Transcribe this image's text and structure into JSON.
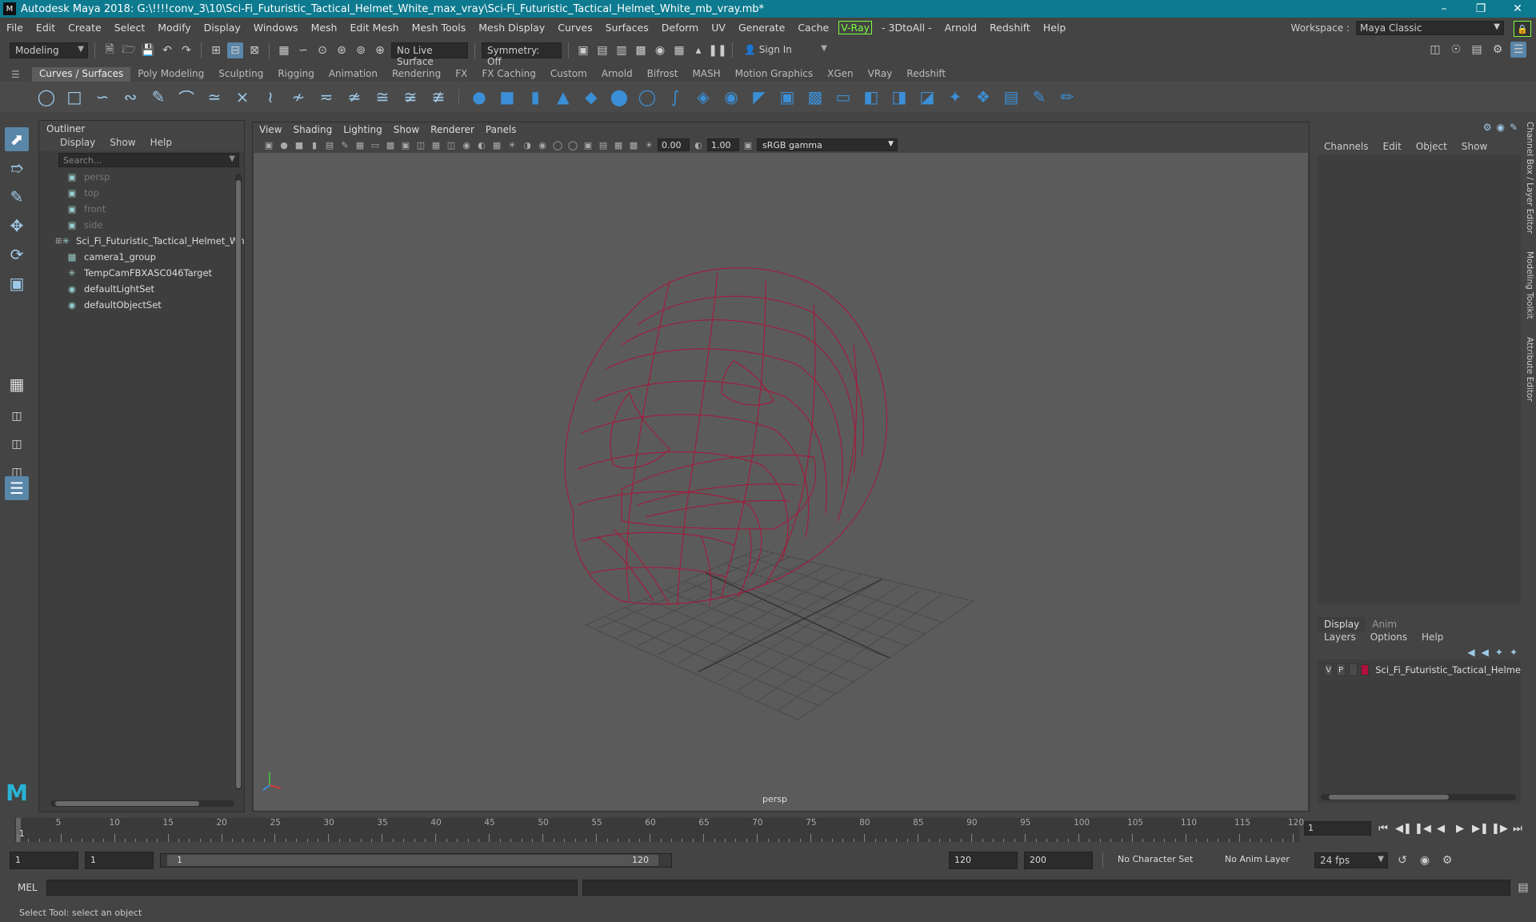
{
  "window": {
    "title": "Autodesk Maya 2018: G:\\!!!!conv_3\\10\\Sci-Fi_Futuristic_Tactical_Helmet_White_max_vray\\Sci-Fi_Futuristic_Tactical_Helmet_White_mb_vray.mb*"
  },
  "menu": [
    "File",
    "Edit",
    "Create",
    "Select",
    "Modify",
    "Display",
    "Windows",
    "Mesh",
    "Edit Mesh",
    "Mesh Tools",
    "Mesh Display",
    "Curves",
    "Surfaces",
    "Deform",
    "UV",
    "Generate",
    "Cache"
  ],
  "menu_vray": "V-Ray",
  "menu2": [
    "- 3DtoAll -",
    "Arnold",
    "Redshift",
    "Help"
  ],
  "workspace": {
    "label": "Workspace :",
    "value": "Maya Classic"
  },
  "status": {
    "mode": "Modeling",
    "live_surface": "No Live Surface",
    "symmetry": "Symmetry: Off",
    "sign_in": "Sign In"
  },
  "shelf_tabs": [
    "Curves / Surfaces",
    "Poly Modeling",
    "Sculpting",
    "Rigging",
    "Animation",
    "Rendering",
    "FX",
    "FX Caching",
    "Custom",
    "Arnold",
    "Bifrost",
    "MASH",
    "Motion Graphics",
    "XGen",
    "VRay",
    "Redshift"
  ],
  "outliner": {
    "title": "Outliner",
    "menu": [
      "Display",
      "Show",
      "Help"
    ],
    "search_placeholder": "Search...",
    "items": [
      {
        "label": "persp",
        "dim": true
      },
      {
        "label": "top",
        "dim": true
      },
      {
        "label": "front",
        "dim": true
      },
      {
        "label": "side",
        "dim": true
      },
      {
        "label": "Sci_Fi_Futuristic_Tactical_Helmet_Whi",
        "dim": false
      },
      {
        "label": "camera1_group",
        "dim": false
      },
      {
        "label": "TempCamFBXASC046Target",
        "dim": false
      },
      {
        "label": "defaultLightSet",
        "dim": false
      },
      {
        "label": "defaultObjectSet",
        "dim": false
      }
    ]
  },
  "viewport": {
    "menu": [
      "View",
      "Shading",
      "Lighting",
      "Show",
      "Renderer",
      "Panels"
    ],
    "exposure": "0.00",
    "gamma": "1.00",
    "colorspace": "sRGB gamma",
    "camera": "persp",
    "wire_color": "#b0103a"
  },
  "channelbox": {
    "menu": [
      "Channels",
      "Edit",
      "Object",
      "Show"
    ]
  },
  "layer_editor": {
    "tabs": [
      "Display",
      "Anim"
    ],
    "menu": [
      "Layers",
      "Options",
      "Help"
    ],
    "layer": {
      "v": "V",
      "p": "P",
      "name": "Sci_Fi_Futuristic_Tactical_Helme"
    }
  },
  "side_tabs": [
    "Channel Box / Layer Editor",
    "Modeling Toolkit",
    "Attribute Editor"
  ],
  "timeline": {
    "ticks": [
      "1",
      "5",
      "10",
      "15",
      "20",
      "25",
      "30",
      "35",
      "40",
      "45",
      "50",
      "55",
      "60",
      "65",
      "70",
      "75",
      "80",
      "85",
      "90",
      "95",
      "100",
      "105",
      "110",
      "115",
      "120"
    ],
    "current": "1"
  },
  "range": {
    "start": "1",
    "playback_start": "1",
    "range_start": "1",
    "range_end": "120",
    "playback_end": "120",
    "end": "200",
    "char_set": "No Character Set",
    "anim_layer": "No Anim Layer",
    "fps": "24 fps"
  },
  "cmd": {
    "label": "MEL"
  },
  "help": "Select Tool: select an object"
}
